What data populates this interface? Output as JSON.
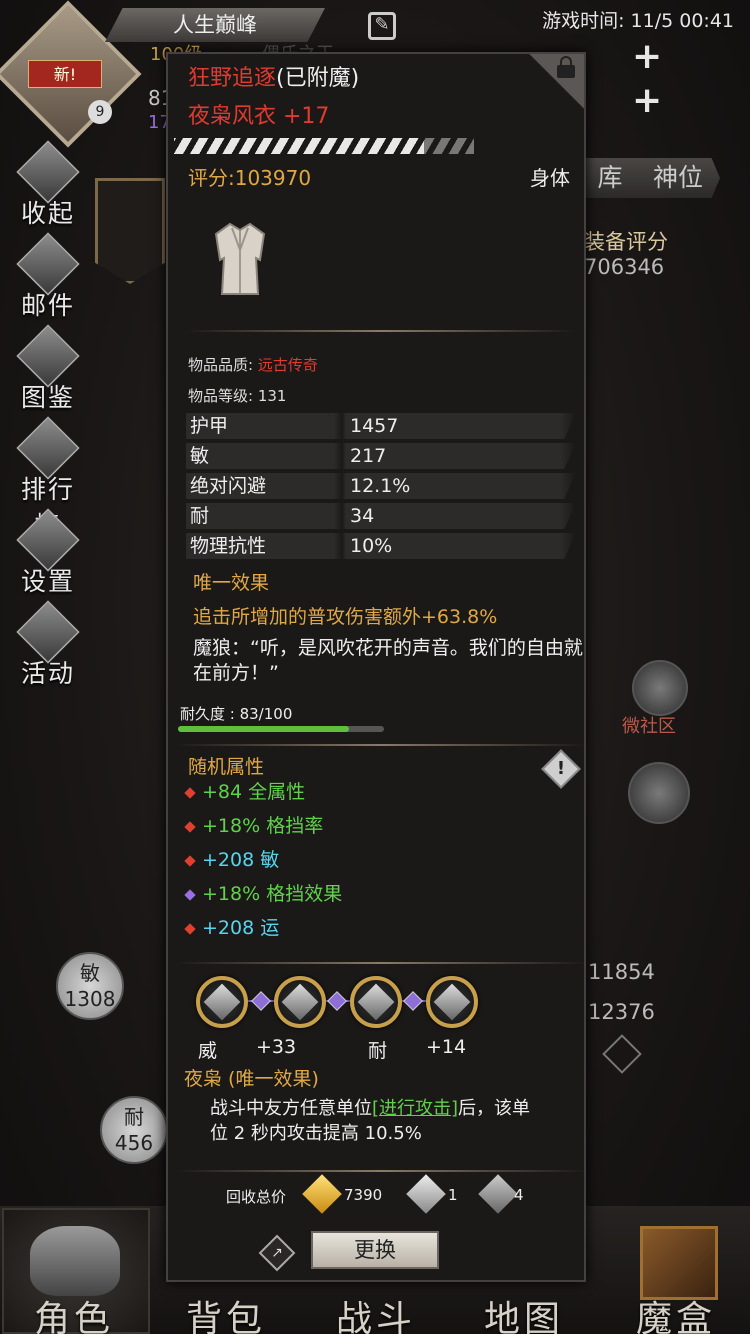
{
  "top": {
    "title": "人生巅峰",
    "game_time": "游戏时间: 11/5 00:41",
    "level_partial": "100级",
    "ghost_name": "偶氏之王",
    "num_81": "81",
    "num_17": "17",
    "level_badge": "9",
    "new_badge": "新!"
  },
  "sidebar": {
    "items": [
      {
        "label": "收起"
      },
      {
        "label": "邮件"
      },
      {
        "label": "图鉴"
      },
      {
        "label": "排行榜"
      },
      {
        "label": "设置"
      },
      {
        "label": "活动"
      }
    ]
  },
  "right_tabs": {
    "tab1": "库",
    "tab2": "神位"
  },
  "equip_score": {
    "label": "装备评分",
    "value": "706346"
  },
  "background_stats": {
    "agi_label": "敏",
    "agi_value": "1308",
    "end_label": "耐",
    "end_value": "456",
    "right_val1": "11854",
    "right_val2": "12376",
    "community": "微社区"
  },
  "tooltip": {
    "prefix_name": "狂野追逐",
    "prefix_state": "(已附魔)",
    "item_name": "夜枭风衣 +17",
    "score": "评分:103970",
    "slot": "身体",
    "quality_label": "物品品质: ",
    "quality_value": "远古传奇",
    "item_level": "物品等级: 131",
    "stats": [
      {
        "name": "护甲",
        "value": "1457"
      },
      {
        "name": "敏",
        "value": "217"
      },
      {
        "name": "绝对闪避",
        "value": "12.1%"
      },
      {
        "name": "耐",
        "value": "34"
      },
      {
        "name": "物理抗性",
        "value": "10%"
      }
    ],
    "unique_title": "唯一效果",
    "unique_text": "追击所增加的普攻伤害额外+63.8%",
    "quote": "魔狼：“听，是风吹花开的声音。我们的自由就在前方！”",
    "durability_label": "耐久度 : 83/100",
    "durability": 0.83,
    "random_title": "随机属性",
    "random_attrs": [
      {
        "text": "+84 全属性",
        "color": "#5fd14a",
        "gem": "#e04030"
      },
      {
        "text": "+18% 格挡率",
        "color": "#5fd14a",
        "gem": "#e04030"
      },
      {
        "text": "+208 敏",
        "color": "#55d6ee",
        "gem": "#e04030"
      },
      {
        "text": "+18% 格挡效果",
        "color": "#5fd14a",
        "gem": "#9a6fe0"
      },
      {
        "text": "+208 运",
        "color": "#55d6ee",
        "gem": "#e04030"
      }
    ],
    "sockets": [
      {
        "label": "威"
      },
      {
        "label": "+33"
      },
      {
        "label": "耐"
      },
      {
        "label": "+14"
      }
    ],
    "set_title": "夜枭 (唯一效果)",
    "set_text_a": "战斗中友方任意单位",
    "set_text_link": "[进行攻击]",
    "set_text_b": "后，该单位 2 秒内攻击提高 10.5%",
    "recycle_label": "回收总价",
    "recycle_gold": "7390",
    "recycle_res1": "1",
    "recycle_res2": "4",
    "replace_button": "更换"
  },
  "bottom_nav": {
    "items": [
      {
        "label": "角色"
      },
      {
        "label": "背包"
      },
      {
        "label": "战斗"
      },
      {
        "label": "地图"
      },
      {
        "label": "魔盒"
      }
    ]
  }
}
